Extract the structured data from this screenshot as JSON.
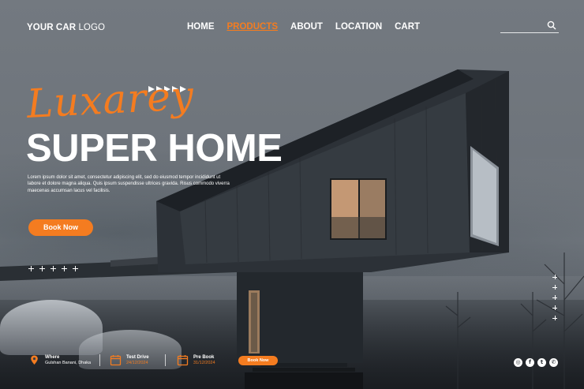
{
  "header": {
    "logo_bold": "YOUR CAR",
    "logo_light": "LOGO",
    "nav": [
      "HOME",
      "PRODUCTS",
      "ABOUT",
      "LOCATION",
      "CART"
    ],
    "active_nav": "PRODUCTS",
    "search_placeholder": "",
    "search_icon": "search-icon"
  },
  "hero": {
    "script_text": "Luxarey",
    "title": "SUPER HOME",
    "description": "Lorem ipsum dolor sit amet, consectetur adipiscing elit, sed do eiusmod tempor incididunt ut labore et dolore magna aliqua. Quis ipsum suspendisse ultrices gravida. Risus commodo viverra maecenas accumsan lacus vel facilisis.",
    "cta": "Book Now"
  },
  "info_bar": {
    "where_label": "Where",
    "where_value": "Gulshan Banani, Dhaka",
    "test_drive_label": "Test Drive",
    "test_drive_value": "24/12/2024",
    "pre_book_label": "Pre Book",
    "pre_book_value": "31/12/2024",
    "cta": "Book Now"
  },
  "social": {
    "icons": [
      "instagram-icon",
      "facebook-icon",
      "twitter-icon",
      "whatsapp-icon"
    ],
    "glyphs": [
      "◎",
      "f",
      "t",
      "✆"
    ]
  },
  "colors": {
    "accent": "#f47c20",
    "text": "#ffffff",
    "background": "#6e747b"
  }
}
